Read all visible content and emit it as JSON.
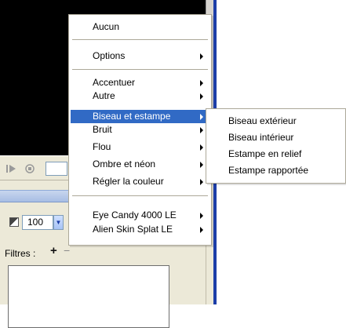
{
  "main_menu": {
    "items": [
      {
        "label": "Aucun"
      },
      {
        "label": "Options",
        "submenu": true
      },
      {
        "label": "Accentuer",
        "submenu": true
      },
      {
        "label": "Autre",
        "submenu": true
      },
      {
        "label": "Biseau et estampe",
        "submenu": true,
        "highlighted": true
      },
      {
        "label": "Bruit",
        "submenu": true
      },
      {
        "label": "Flou",
        "submenu": true
      },
      {
        "label": "Ombre et néon",
        "submenu": true
      },
      {
        "label": "Régler la couleur",
        "submenu": true
      },
      {
        "label": "Eye Candy 4000 LE",
        "submenu": true
      },
      {
        "label": "Alien Skin Splat LE",
        "submenu": true
      }
    ]
  },
  "sub_menu": {
    "items": [
      {
        "label": "Biseau extérieur"
      },
      {
        "label": "Biseau intérieur"
      },
      {
        "label": "Estampe en relief"
      },
      {
        "label": "Estampe rapportée"
      }
    ]
  },
  "panel": {
    "opacity_value": "100",
    "filters_label": "Filtres :"
  },
  "colors": {
    "highlight": "#316ac5",
    "panel_bg": "#ece9d8",
    "accent_blue": "#1c3ea8"
  },
  "icons": [
    "play-icon",
    "stop-icon",
    "opacity-icon",
    "add-filter-icon",
    "remove-filter-icon",
    "submenu-arrow-icon",
    "dropdown-arrow-icon"
  ]
}
